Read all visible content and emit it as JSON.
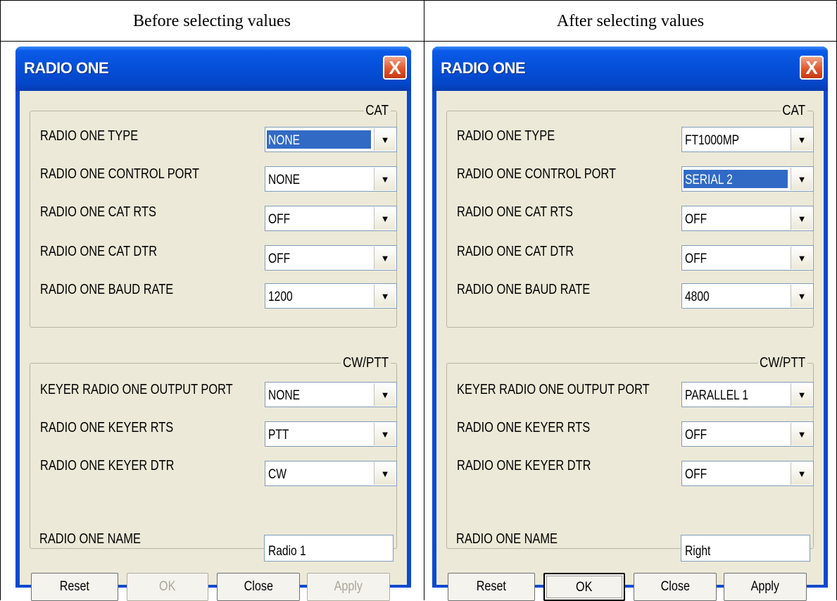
{
  "headings": {
    "before": "Before selecting values",
    "after": "After selecting values"
  },
  "dialogs": [
    {
      "title": "RADIO ONE",
      "close_glyph": "X",
      "cat_legend": "CAT",
      "cw_legend": "CW/PTT",
      "fields": {
        "radio_type": {
          "label": "RADIO ONE TYPE",
          "value": "NONE"
        },
        "control_port": {
          "label": "RADIO ONE CONTROL PORT",
          "value": "NONE"
        },
        "cat_rts": {
          "label": "RADIO ONE CAT RTS",
          "value": "OFF"
        },
        "cat_dtr": {
          "label": "RADIO ONE CAT DTR",
          "value": "OFF"
        },
        "baud_rate": {
          "label": "RADIO ONE BAUD RATE",
          "value": "1200"
        },
        "keyer_output_port": {
          "label": "KEYER RADIO ONE OUTPUT PORT",
          "value": "NONE"
        },
        "keyer_rts": {
          "label": "RADIO ONE KEYER RTS",
          "value": "PTT"
        },
        "keyer_dtr": {
          "label": "RADIO ONE KEYER DTR",
          "value": "CW"
        },
        "radio_name": {
          "label": "RADIO ONE NAME",
          "value": "Radio 1"
        }
      },
      "buttons": {
        "reset": "Reset",
        "ok": "OK",
        "close": "Close",
        "apply": "Apply"
      }
    },
    {
      "title": "RADIO ONE",
      "close_glyph": "X",
      "cat_legend": "CAT",
      "cw_legend": "CW/PTT",
      "fields": {
        "radio_type": {
          "label": "RADIO ONE TYPE",
          "value": "FT1000MP"
        },
        "control_port": {
          "label": "RADIO ONE CONTROL PORT",
          "value": "SERIAL 2"
        },
        "cat_rts": {
          "label": "RADIO ONE CAT RTS",
          "value": "OFF"
        },
        "cat_dtr": {
          "label": "RADIO ONE CAT DTR",
          "value": "OFF"
        },
        "baud_rate": {
          "label": "RADIO ONE BAUD RATE",
          "value": "4800"
        },
        "keyer_output_port": {
          "label": "KEYER RADIO ONE OUTPUT PORT",
          "value": "PARALLEL 1"
        },
        "keyer_rts": {
          "label": "RADIO ONE KEYER RTS",
          "value": "OFF"
        },
        "keyer_dtr": {
          "label": "RADIO ONE KEYER DTR",
          "value": "OFF"
        },
        "radio_name": {
          "label": "RADIO ONE NAME",
          "value": "Right"
        }
      },
      "buttons": {
        "reset": "Reset",
        "ok": "OK",
        "close": "Close",
        "apply": "Apply"
      }
    }
  ],
  "dropdown_arrow_glyph": "▼",
  "colors": {
    "titlebar": "#0550d9",
    "dialog_face": "#ece9d8",
    "selection": "#316ac5",
    "close_button": "#e2572c",
    "disabled_text": "#a9a799"
  }
}
